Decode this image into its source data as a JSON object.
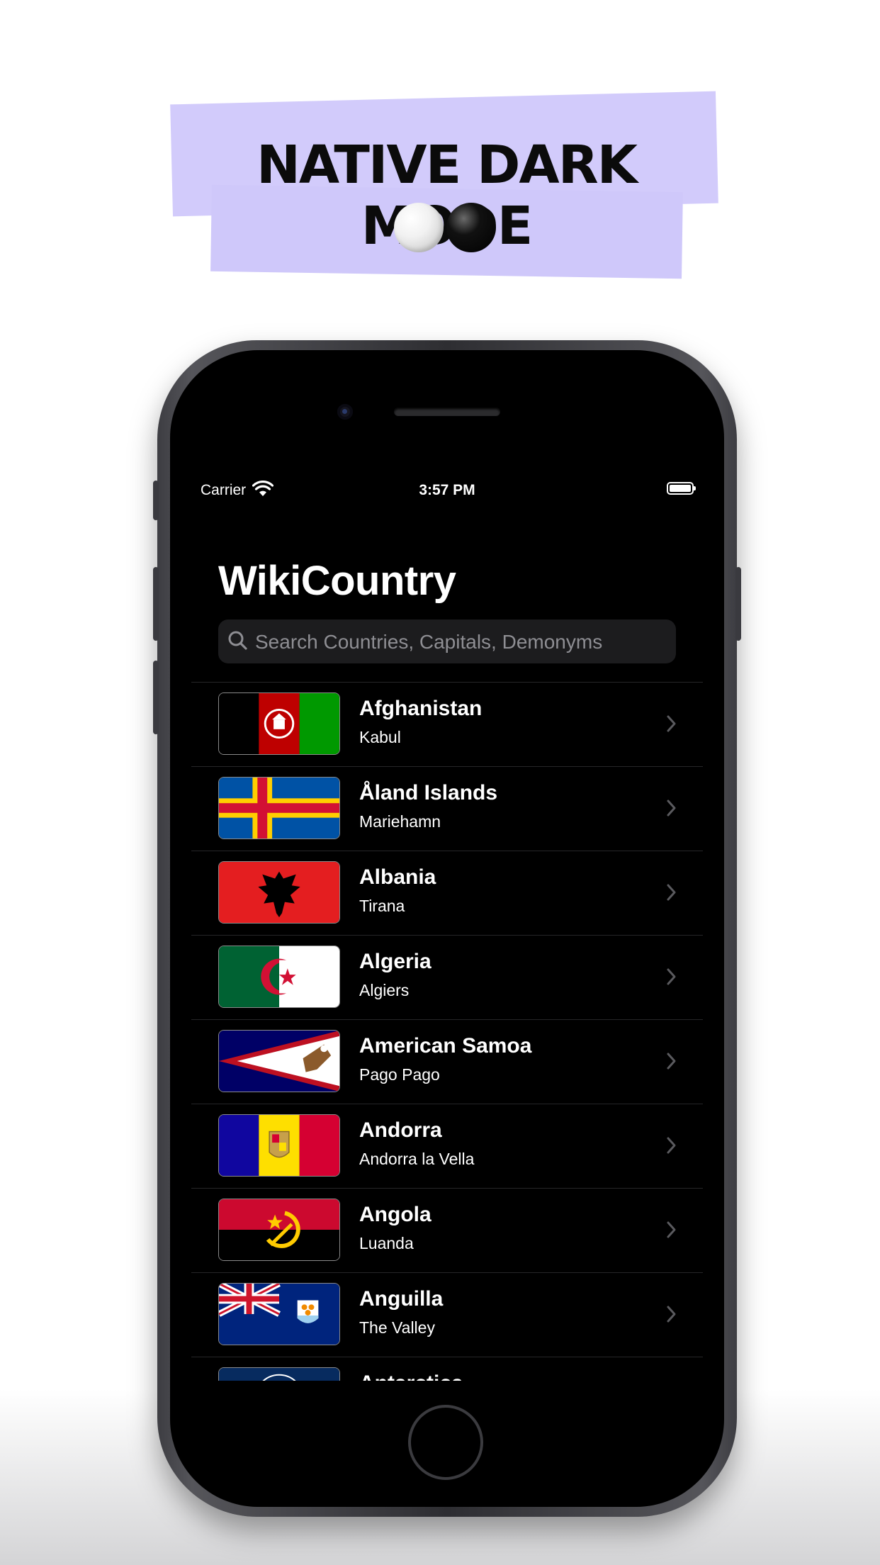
{
  "banner": {
    "title": "NATIVE DARK MODE",
    "colors": {
      "tape": "#d2cbfb"
    }
  },
  "status_bar": {
    "carrier": "Carrier",
    "time": "3:57 PM"
  },
  "app": {
    "title": "WikiCountry",
    "search_placeholder": "Search Countries, Capitals, Demonyms"
  },
  "countries": [
    {
      "name": "Afghanistan",
      "capital": "Kabul",
      "flag": "afghanistan-flag"
    },
    {
      "name": "Åland Islands",
      "capital": "Mariehamn",
      "flag": "aland-flag"
    },
    {
      "name": "Albania",
      "capital": "Tirana",
      "flag": "albania-flag"
    },
    {
      "name": "Algeria",
      "capital": "Algiers",
      "flag": "algeria-flag"
    },
    {
      "name": "American Samoa",
      "capital": "Pago Pago",
      "flag": "american-samoa-flag"
    },
    {
      "name": "Andorra",
      "capital": "Andorra la Vella",
      "flag": "andorra-flag"
    },
    {
      "name": "Angola",
      "capital": "Luanda",
      "flag": "angola-flag"
    },
    {
      "name": "Anguilla",
      "capital": "The Valley",
      "flag": "anguilla-flag"
    },
    {
      "name": "Antarctica",
      "capital": "",
      "flag": "antarctica-flag"
    }
  ]
}
